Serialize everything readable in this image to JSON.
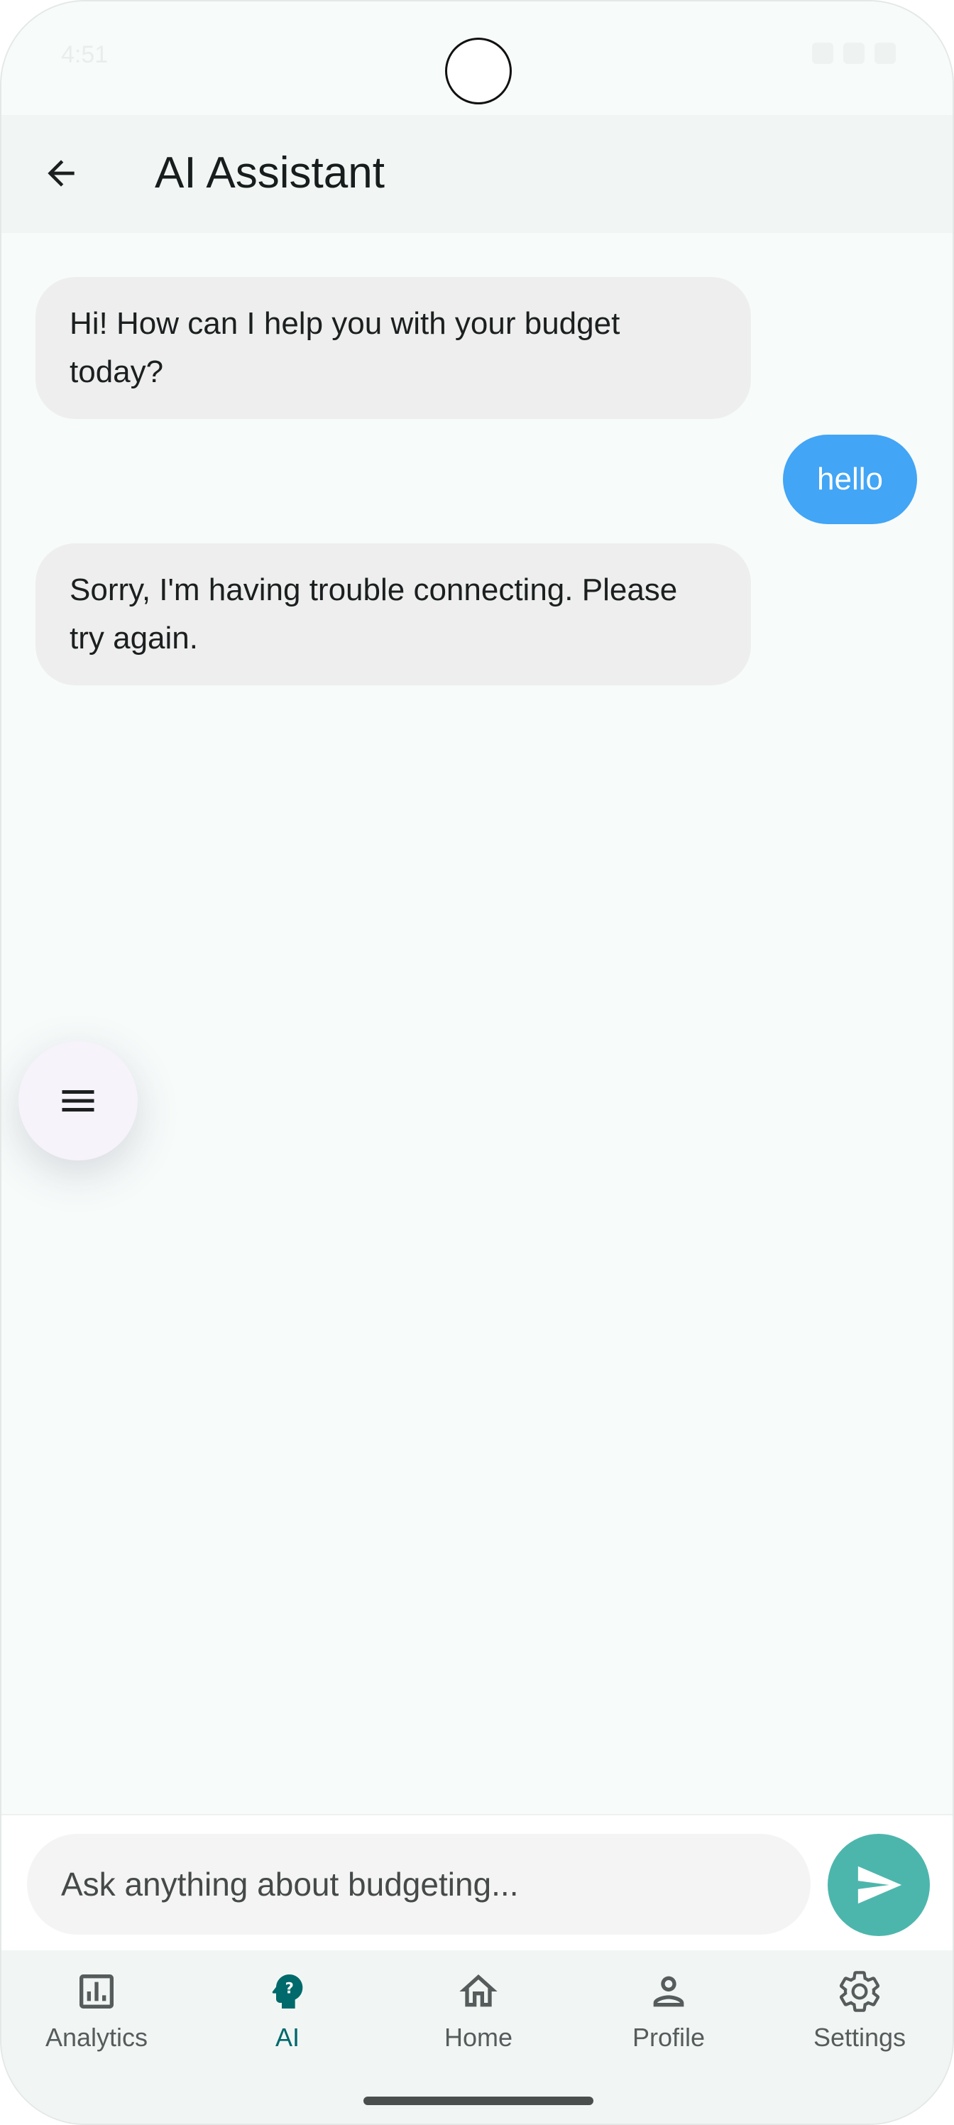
{
  "status_bar": {
    "time": "4:51"
  },
  "app_bar": {
    "title": "AI Assistant",
    "back_icon": "arrow-back-icon"
  },
  "messages": [
    {
      "sender": "assistant",
      "text": "Hi! How can I help you with your budget today?"
    },
    {
      "sender": "user",
      "text": "hello"
    },
    {
      "sender": "assistant",
      "text": "Sorry, I'm having trouble connecting. Please try again."
    }
  ],
  "menu_button": {
    "icon": "menu-icon"
  },
  "composer": {
    "placeholder": "Ask anything about budgeting...",
    "send_icon": "send-icon"
  },
  "nav": {
    "items": [
      {
        "label": "Analytics",
        "icon": "analytics-icon",
        "active": false
      },
      {
        "label": "AI",
        "icon": "ai-help-icon",
        "active": true
      },
      {
        "label": "Home",
        "icon": "home-icon",
        "active": false
      },
      {
        "label": "Profile",
        "icon": "profile-icon",
        "active": false
      },
      {
        "label": "Settings",
        "icon": "settings-icon",
        "active": false
      }
    ]
  },
  "colors": {
    "user_bubble": "#42a5f5",
    "bot_bubble": "#eeeeee",
    "send_button": "#4db6ac",
    "active_nav": "#00696b"
  }
}
